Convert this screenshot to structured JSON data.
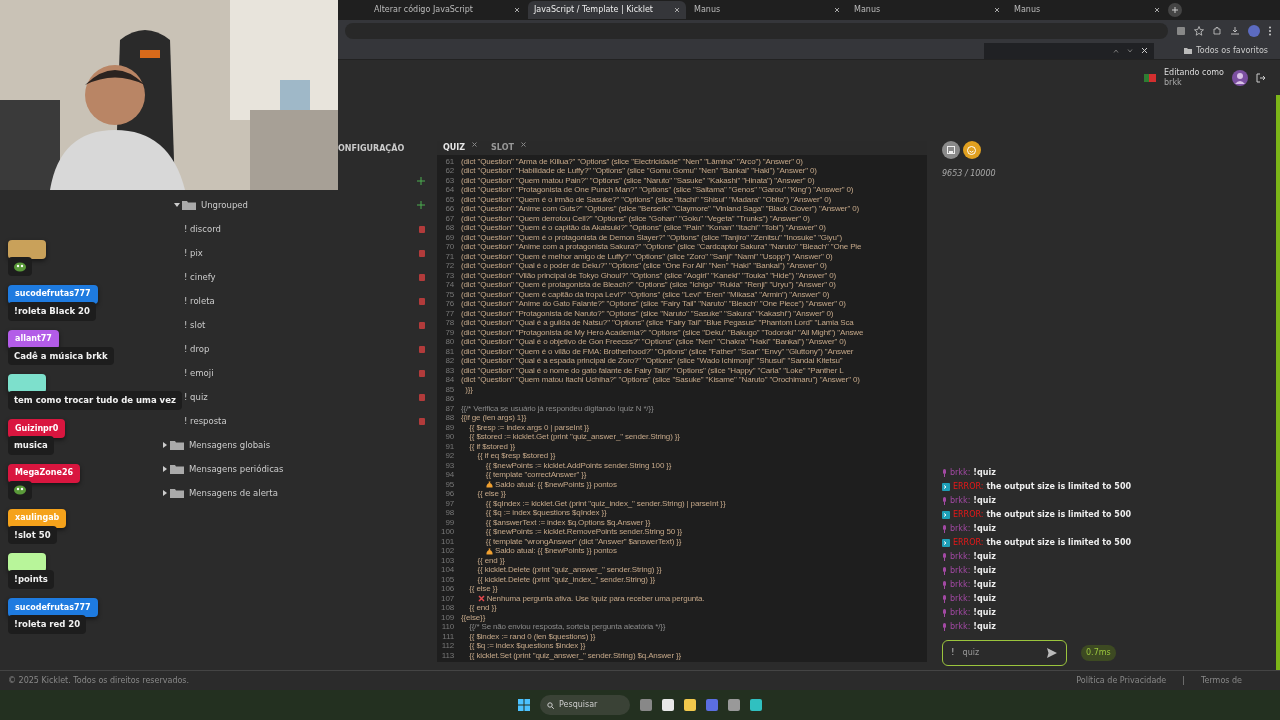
{
  "browser": {
    "tabs": [
      {
        "label": "Alterar código JavaScript",
        "selected": false
      },
      {
        "label": "JavaScript / Template | Kicklet",
        "selected": true
      },
      {
        "label": "Manus",
        "selected": false
      },
      {
        "label": "Manus",
        "selected": false
      },
      {
        "label": "Manus",
        "selected": false
      }
    ],
    "bookmarks": "Todos os favoritos"
  },
  "header": {
    "editing_label": "Editando como",
    "user": "brkk"
  },
  "sidebar": {
    "section_title": "ONFIGURAÇÃO",
    "tree": [
      {
        "label": "Ungrouped",
        "expanded": true,
        "children": [
          {
            "label": "! discord"
          },
          {
            "label": "! pix"
          },
          {
            "label": "! cinefy"
          },
          {
            "label": "! roleta"
          },
          {
            "label": "! slot"
          },
          {
            "label": "! drop"
          },
          {
            "label": "! emoji"
          },
          {
            "label": "! quiz"
          },
          {
            "label": "! resposta"
          }
        ]
      },
      {
        "label": "Mensagens globais",
        "expanded": false
      },
      {
        "label": "Mensagens periódicas",
        "expanded": false
      },
      {
        "label": "Mensagens de alerta",
        "expanded": false
      }
    ]
  },
  "editor": {
    "tabs": [
      {
        "label": "QUIZ",
        "selected": true
      },
      {
        "label": "SLOT",
        "selected": false
      }
    ],
    "lines": [
      {
        "number": "61",
        "kind": "code",
        "text": "(dict \"Question\" \"Arma de Killua?\" \"Options\" (slice \"Electricidade\" \"Nen\" \"Lâmina\" \"Arco\") \"Answer\" 0)"
      },
      {
        "number": "62",
        "kind": "code",
        "text": "(dict \"Question\" \"Habilidade de Luffy?\" \"Options\" (slice \"Gomu Gomu\" \"Nen\" \"Bankai\" \"Haki\") \"Answer\" 0)"
      },
      {
        "number": "63",
        "kind": "code",
        "text": "(dict \"Question\" \"Quem matou Pain?\" \"Options\" (slice \"Naruto\" \"Sasuke\" \"Kakashi\" \"Hinata\") \"Answer\" 0)"
      },
      {
        "number": "64",
        "kind": "code",
        "text": "(dict \"Question\" \"Protagonista de One Punch Man?\" \"Options\" (slice \"Saitama\" \"Genos\" \"Garou\" \"King\") \"Answer\" 0)"
      },
      {
        "number": "65",
        "kind": "code",
        "text": "(dict \"Question\" \"Quem é o irmão de Sasuke?\" \"Options\" (slice \"Itachi\" \"Shisui\" \"Madara\" \"Obito\") \"Answer\" 0)"
      },
      {
        "number": "66",
        "kind": "code",
        "text": "(dict \"Question\" \"Anime com Guts?\" \"Options\" (slice \"Berserk\" \"Claymore\" \"Vinland Saga\" \"Black Clover\") \"Answer\" 0)"
      },
      {
        "number": "67",
        "kind": "code",
        "text": "(dict \"Question\" \"Quem derrotou Cell?\" \"Options\" (slice \"Gohan\" \"Goku\" \"Vegeta\" \"Trunks\") \"Answer\" 0)"
      },
      {
        "number": "68",
        "kind": "code",
        "text": "(dict \"Question\" \"Quem é o capitão da Akatsuki?\" \"Options\" (slice \"Pain\" \"Konan\" \"Itachi\" \"Tobi\") \"Answer\" 0)"
      },
      {
        "number": "69",
        "kind": "code",
        "text": "(dict \"Question\" \"Quem é o protagonista de Demon Slayer?\" \"Options\" (slice \"Tanjiro\" \"Zenitsu\" \"Inosuke\" \"Giyu\")"
      },
      {
        "number": "70",
        "kind": "code",
        "text": "(dict \"Question\" \"Anime com a protagonista Sakura?\" \"Options\" (slice \"Cardcaptor Sakura\" \"Naruto\" \"Bleach\" \"One Pie"
      },
      {
        "number": "71",
        "kind": "code",
        "text": "(dict \"Question\" \"Quem é melhor amigo de Luffy?\" \"Options\" (slice \"Zoro\" \"Sanji\" \"Nami\" \"Usopp\") \"Answer\" 0)"
      },
      {
        "number": "72",
        "kind": "code",
        "text": "(dict \"Question\" \"Qual é o poder de Deku?\" \"Options\" (slice \"One For All\" \"Nen\" \"Haki\" \"Bankai\") \"Answer\" 0)"
      },
      {
        "number": "73",
        "kind": "code",
        "text": "(dict \"Question\" \"Vilão principal de Tokyo Ghoul?\" \"Options\" (slice \"Aogiri\" \"Kaneki\" \"Touka\" \"Hide\") \"Answer\" 0)"
      },
      {
        "number": "74",
        "kind": "code",
        "text": "(dict \"Question\" \"Quem é protagonista de Bleach?\" \"Options\" (slice \"Ichigo\" \"Rukia\" \"Renji\" \"Uryu\") \"Answer\" 0)"
      },
      {
        "number": "75",
        "kind": "code",
        "text": "(dict \"Question\" \"Quem é capitão da tropa Levi?\" \"Options\" (slice \"Levi\" \"Eren\" \"Mikasa\" \"Armin\") \"Answer\" 0)"
      },
      {
        "number": "76",
        "kind": "code",
        "text": "(dict \"Question\" \"Anime do Gato Falante?\" \"Options\" (slice \"Fairy Tail\" \"Naruto\" \"Bleach\" \"One Piece\") \"Answer\" 0)"
      },
      {
        "number": "77",
        "kind": "code",
        "text": "(dict \"Question\" \"Protagonista de Naruto?\" \"Options\" (slice \"Naruto\" \"Sasuke\" \"Sakura\" \"Kakashi\") \"Answer\" 0)"
      },
      {
        "number": "78",
        "kind": "code",
        "text": "(dict \"Question\" \"Qual é a guilda de Natsu?\" \"Options\" (slice \"Fairy Tail\" \"Blue Pegasus\" \"Phantom Lord\" \"Lamia Sca"
      },
      {
        "number": "79",
        "kind": "code",
        "text": "(dict \"Question\" \"Protagonista de My Hero Academia?\" \"Options\" (slice \"Deku\" \"Bakugo\" \"Todoroki\" \"All Might\") \"Answe"
      },
      {
        "number": "80",
        "kind": "code",
        "text": "(dict \"Question\" \"Qual é o objetivo de Gon Freecss?\" \"Options\" (slice \"Nen\" \"Chakra\" \"Haki\" \"Bankai\") \"Answer\" 0)"
      },
      {
        "number": "81",
        "kind": "code",
        "text": "(dict \"Question\" \"Quem é o vilão de FMA: Brotherhood?\" \"Options\" (slice \"Father\" \"Scar\" \"Envy\" \"Gluttony\") \"Answer"
      },
      {
        "number": "82",
        "kind": "code",
        "text": "(dict \"Question\" \"Qual é a espada principal de Zoro?\" \"Options\" (slice \"Wado Ichimonji\" \"Shusui\" \"Sandai Kitetsu\""
      },
      {
        "number": "83",
        "kind": "code",
        "text": "(dict \"Question\" \"Qual é o nome do gato falante de Fairy Tail?\" \"Options\" (slice \"Happy\" \"Carla\" \"Loke\" \"Panther L"
      },
      {
        "number": "84",
        "kind": "code",
        "text": "(dict \"Question\" \"Quem matou Itachi Uchiha?\" \"Options\" (slice \"Sasuke\" \"Kisame\" \"Naruto\" \"Orochimaru\") \"Answer\" 0)"
      },
      {
        "number": "85",
        "kind": "code",
        "text": "  )}}"
      },
      {
        "number": "86",
        "kind": "code"
      },
      {
        "number": "87",
        "kind": "comment",
        "text": "{{/* Verifica se usuário já respondeu digitando !quiz N */}}"
      },
      {
        "number": "88",
        "kind": "code",
        "text": "{{if ge (len args) 1}}"
      },
      {
        "number": "89",
        "kind": "code",
        "text": "    {{ $resp := index args 0 | parseInt }}"
      },
      {
        "number": "90",
        "kind": "code",
        "text": "    {{ $stored := kicklet.Get (print \"quiz_answer_\" sender.String) }}"
      },
      {
        "number": "91",
        "kind": "code",
        "text": "    {{ if $stored }}"
      },
      {
        "number": "92",
        "kind": "code",
        "text": "        {{ if eq $resp $stored }}"
      },
      {
        "number": "93",
        "kind": "code",
        "text": "            {{ $newPoints := kicklet.AddPoints sender.String 100 }}"
      },
      {
        "number": "94",
        "kind": "code",
        "text": "            {{ template \"correctAnswer\" }}"
      },
      {
        "number": "95",
        "kind": "bag",
        "text": "            Saldo atual: {{ $newPoints }} pontos"
      },
      {
        "number": "96",
        "kind": "code",
        "text": "        {{ else }}"
      },
      {
        "number": "97",
        "kind": "code",
        "text": "            {{ $qIndex := kicklet.Get (print \"quiz_index_\" sender.String) | parseInt }}"
      },
      {
        "number": "98",
        "kind": "code",
        "text": "            {{ $q := index $questions $qIndex }}"
      },
      {
        "number": "99",
        "kind": "code",
        "text": "            {{ $answerText := index $q.Options $q.Answer }}"
      },
      {
        "number": "100",
        "kind": "code",
        "text": "            {{ $newPoints := kicklet.RemovePoints sender.String 50 }}"
      },
      {
        "number": "101",
        "kind": "code",
        "text": "            {{ template \"wrongAnswer\" (dict \"Answer\" $answerText) }}"
      },
      {
        "number": "102",
        "kind": "bag",
        "text": "            Saldo atual: {{ $newPoints }} pontos"
      },
      {
        "number": "103",
        "kind": "code",
        "text": "        {{ end }}"
      },
      {
        "number": "104",
        "kind": "code",
        "text": "        {{ kicklet.Delete (print \"quiz_answer_\" sender.String) }}"
      },
      {
        "number": "105",
        "kind": "code",
        "text": "        {{ kicklet.Delete (print \"quiz_index_\" sender.String) }}"
      },
      {
        "number": "106",
        "kind": "code",
        "text": "    {{ else }}"
      },
      {
        "number": "107",
        "kind": "cross",
        "text": "        Nenhuma pergunta ativa. Use !quiz para receber uma pergunta."
      },
      {
        "number": "108",
        "kind": "code",
        "text": "    {{ end }}"
      },
      {
        "number": "109",
        "kind": "code",
        "text": "{{else}}"
      },
      {
        "number": "110",
        "kind": "comment",
        "text": "    {{/* Se não enviou resposta, sorteia pergunta aleatória */}}"
      },
      {
        "number": "111",
        "kind": "code",
        "text": "    {{ $index := rand 0 (len $questions) }}"
      },
      {
        "number": "112",
        "kind": "code",
        "text": "    {{ $q := index $questions $index }}"
      },
      {
        "number": "113",
        "kind": "code",
        "text": "    {{ kicklet.Set (print \"quiz_answer_\" sender.String) $q.Answer }}"
      }
    ]
  },
  "panel": {
    "counter": "9653 / 10000",
    "console": [
      {
        "kind": "user",
        "author": "brkk:",
        "text": "!quiz"
      },
      {
        "kind": "error",
        "author": "ERROR:",
        "text": "the output size is limited to 500"
      },
      {
        "kind": "user",
        "author": "brkk:",
        "text": "!quiz"
      },
      {
        "kind": "error",
        "author": "ERROR:",
        "text": "the output size is limited to 500"
      },
      {
        "kind": "user",
        "author": "brkk:",
        "text": "!quiz"
      },
      {
        "kind": "error",
        "author": "ERROR:",
        "text": "the output size is limited to 500"
      },
      {
        "kind": "user",
        "author": "brkk:",
        "text": "!quiz"
      },
      {
        "kind": "user",
        "author": "brkk:",
        "text": "!quiz"
      },
      {
        "kind": "user",
        "author": "brkk:",
        "text": "!quiz"
      },
      {
        "kind": "user",
        "author": "brkk:",
        "text": "!quiz"
      },
      {
        "kind": "user",
        "author": "brkk:",
        "text": "!quiz"
      },
      {
        "kind": "user",
        "author": "brkk:",
        "text": "!quiz"
      }
    ],
    "input": {
      "prefix": "!",
      "value": "quiz"
    },
    "latency": "0.7ms"
  },
  "chat_overlay": [
    {
      "kind": "emote",
      "color": "#c9a15a"
    },
    {
      "kind": "text",
      "user": "sucodefrutas777",
      "color": "#1e7be0",
      "message": "!roleta Black 20"
    },
    {
      "kind": "text",
      "user": "allant77",
      "color": "#b35ce8",
      "message": "Cadê a música brkk"
    },
    {
      "kind": "text",
      "color": "#7de0cc",
      "message": "tem como trocar tudo de uma vez"
    },
    {
      "kind": "text",
      "user": "Guizinpr0",
      "color": "#d9163f",
      "message": "musica"
    },
    {
      "kind": "emote",
      "user": "MegaZone26",
      "color": "#d9163f"
    },
    {
      "kind": "text",
      "user": "xaulingab",
      "color": "#f5a21b",
      "message": "!slot 50"
    },
    {
      "kind": "text",
      "color": "#b8f59a",
      "message": "!points"
    },
    {
      "kind": "text",
      "user": "sucodefrutas777",
      "color": "#1e7be0",
      "message": "!roleta red 20"
    }
  ],
  "footer": {
    "copyright": "© 2025 Kicklet. Todos os direitos reservados.",
    "links": [
      "Política de Privacidade",
      "Termos de"
    ],
    "separator": "|"
  },
  "taskbar": {
    "search_placeholder": "Pesquisar"
  }
}
